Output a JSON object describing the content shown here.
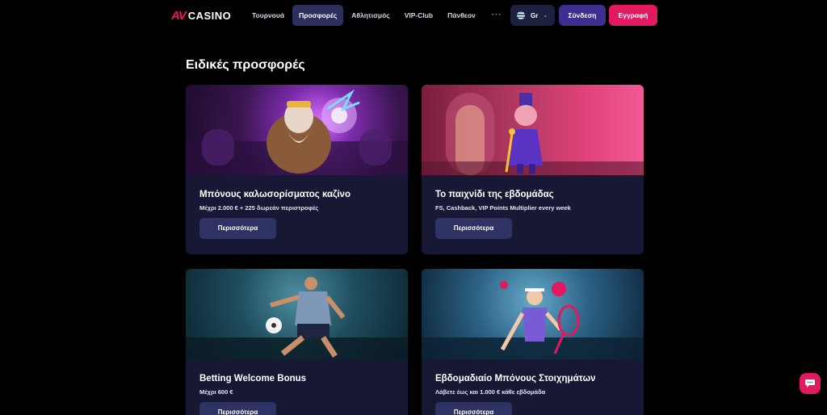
{
  "header": {
    "logo_mark": "AV",
    "logo_text": "CASINO",
    "nav": [
      {
        "label": "Τουρνουά",
        "active": false
      },
      {
        "label": "Προσφορές",
        "active": true
      },
      {
        "label": "Αθλητισμός",
        "active": false
      },
      {
        "label": "VIP-Club",
        "active": false
      },
      {
        "label": "Πάνθεον",
        "active": false
      }
    ],
    "more_label": "···",
    "language": {
      "label": "Gr",
      "flag_icon": "greece-flag-icon"
    },
    "login_label": "Σύνδεση",
    "register_label": "Εγγραφή"
  },
  "page_title": "Ειδικές προσφορές",
  "offers": [
    {
      "title": "Μπόνους καλωσορίσματος καζίνο",
      "subtitle": "Μέχρι 2.000 € + 225 δωρεάν περιστροφές",
      "button": "Περισσότερα",
      "image": "zeus-illustration"
    },
    {
      "title": "Το παιχνίδι της εβδομάδας",
      "subtitle": "FS, Cashback, VIP Points Multiplier every week",
      "button": "Περισσότερα",
      "image": "pig-gentleman-illustration"
    },
    {
      "title": "Betting Welcome Bonus",
      "subtitle": "Μέχρι 600 €",
      "button": "Περισσότερα",
      "image": "soccer-player-illustration"
    },
    {
      "title": "Εβδομαδιαίο Μπόνους Στοιχημάτων",
      "subtitle": "Λάβετε έως και 1.000 € κάθε εβδομάδα",
      "button": "Περισσότερα",
      "image": "tennis-player-illustration"
    }
  ],
  "colors": {
    "accent": "#e21861",
    "login": "#3d2e8f",
    "card_bg": "#161834",
    "active_nav": "#2c2f5c"
  },
  "chat_icon": "chat-bubble-icon"
}
